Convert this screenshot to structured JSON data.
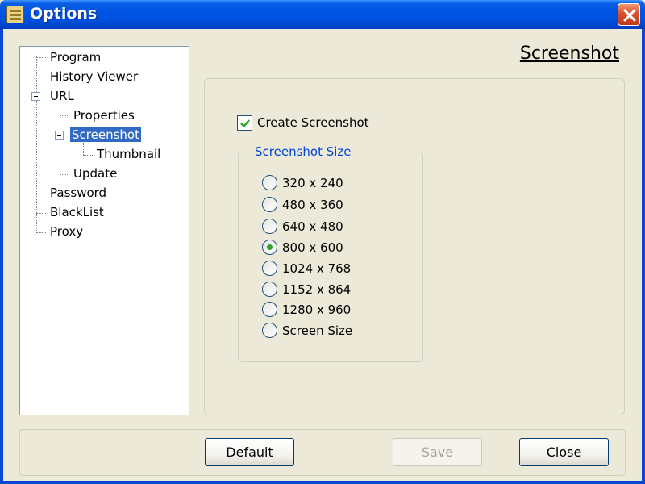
{
  "window": {
    "title": "Options",
    "icon": "options-app-icon",
    "close_icon": "close-icon"
  },
  "tree": {
    "items": [
      {
        "label": "Program",
        "level": 0
      },
      {
        "label": "History Viewer",
        "level": 0
      },
      {
        "label": "URL",
        "level": 0,
        "expanded": true
      },
      {
        "label": "Properties",
        "level": 1
      },
      {
        "label": "Screenshot",
        "level": 1,
        "expanded": true,
        "selected": true
      },
      {
        "label": "Thumbnail",
        "level": 2
      },
      {
        "label": "Update",
        "level": 1
      },
      {
        "label": "Password",
        "level": 0
      },
      {
        "label": "BlackList",
        "level": 0
      },
      {
        "label": "Proxy",
        "level": 0
      }
    ]
  },
  "page": {
    "title": "Screenshot",
    "create_screenshot": {
      "label": "Create Screenshot",
      "checked": true
    },
    "size_group": {
      "legend": "Screenshot Size",
      "options": [
        "320 x 240",
        "480 x 360",
        "640 x 480",
        "800 x 600",
        "1024 x 768",
        "1152 x 864",
        "1280 x 960",
        "Screen Size"
      ],
      "selected": "800 x 600"
    }
  },
  "buttons": {
    "default_label": "Default",
    "save_label": "Save",
    "close_label": "Close",
    "save_enabled": false
  },
  "colors": {
    "selection": "#316ac5",
    "group_legend": "#0046d5",
    "radio_dot": "#2fa02f",
    "titlebar": "#0054e3"
  }
}
